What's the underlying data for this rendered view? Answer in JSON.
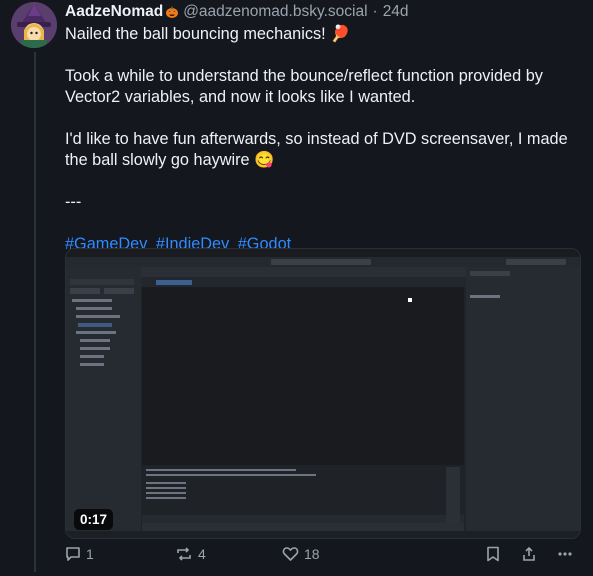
{
  "author": {
    "display_name": "AadzeNomad",
    "handle": "@aadzenomad.bsky.social",
    "separator": "·",
    "time": "24d"
  },
  "post": {
    "line1": "Nailed the ball bouncing mechanics! 🏓",
    "para2": "Took a while to understand the bounce/reflect function provided by Vector2 variables, and now it looks like I wanted.",
    "para3": "I'd like to have fun afterwards, so instead of DVD screensaver, I made the ball slowly go haywire 😋",
    "divider": "---",
    "hashtags": [
      "#GameDev",
      "#IndieDev",
      "#Godot"
    ]
  },
  "video": {
    "duration": "0:17"
  },
  "actions": {
    "reply_count": "1",
    "repost_count": "4",
    "like_count": "18"
  },
  "colors": {
    "background": "#14171d",
    "link": "#2f8bff",
    "muted": "#9aa3ae"
  }
}
